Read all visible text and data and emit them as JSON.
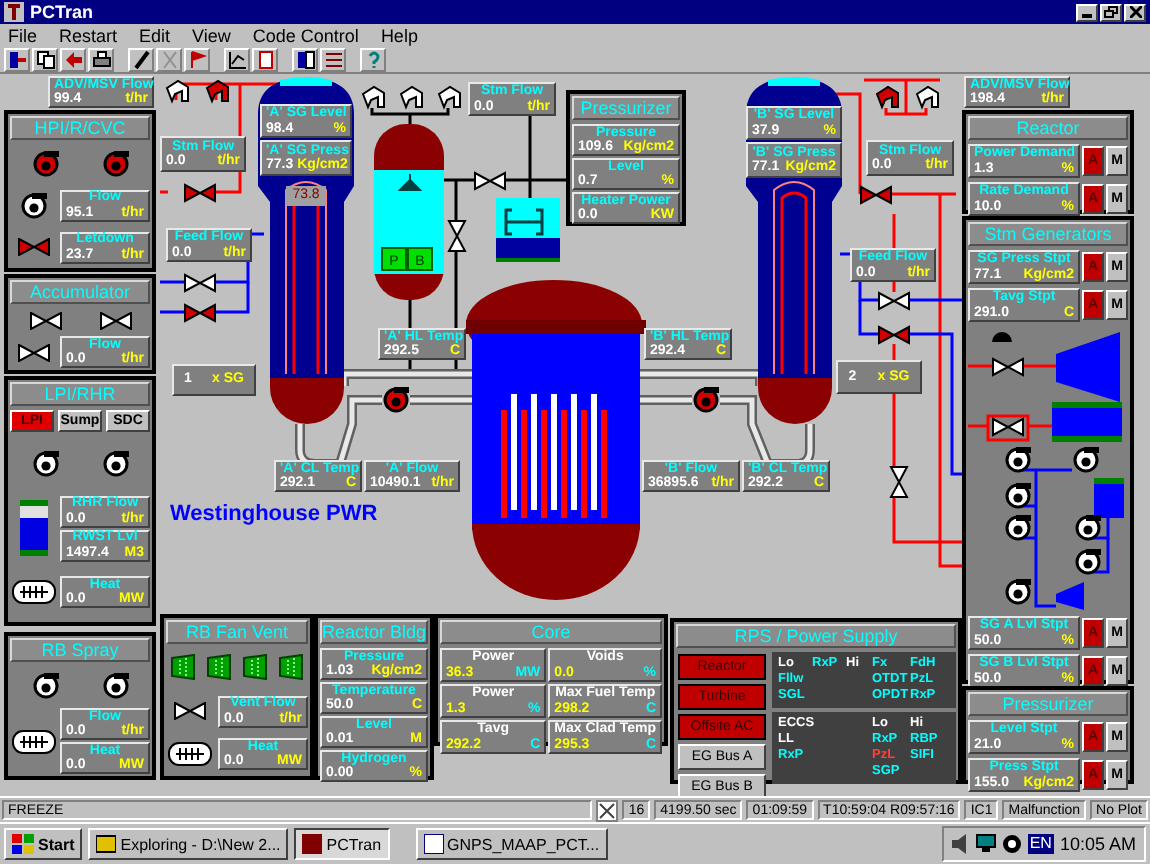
{
  "window": {
    "title": "PCTran"
  },
  "menu": [
    "File",
    "Restart",
    "Edit",
    "View",
    "Code Control",
    "Help"
  ],
  "plant": {
    "caption": "Westinghouse PWR",
    "readouts": [
      {
        "label": "ADV/MSV Flow",
        "value": "99.4",
        "unit": "t/hr"
      },
      {
        "label": "Stm Flow",
        "value": "0.0",
        "unit": "t/hr"
      },
      {
        "label": "'A' SG Level",
        "value": "98.4",
        "unit": "%"
      },
      {
        "label": "'A' SG Press",
        "value": "77.3",
        "unit": "Kg/cm2"
      },
      {
        "label": "Stm Flow",
        "value": "0.0",
        "unit": "t/hr"
      },
      {
        "label": "'B' SG Level",
        "value": "37.9",
        "unit": "%"
      },
      {
        "label": "'B' SG Press",
        "value": "77.1",
        "unit": "Kg/cm2"
      },
      {
        "label": "Stm Flow",
        "value": "0.0",
        "unit": "t/hr"
      },
      {
        "label": "ADV/MSV Flow",
        "value": "198.4",
        "unit": "t/hr"
      },
      {
        "label": "Feed Flow",
        "value": "0.0",
        "unit": "t/hr"
      },
      {
        "label": "Feed Flow",
        "value": "0.0",
        "unit": "t/hr"
      },
      {
        "label": "'A' HL Temp",
        "value": "292.5",
        "unit": "C"
      },
      {
        "label": "'B' HL Temp",
        "value": "292.4",
        "unit": "C"
      },
      {
        "label": "'A' CL Temp",
        "value": "292.1",
        "unit": "C"
      },
      {
        "label": "'A' Flow",
        "value": "10490.1",
        "unit": "t/hr"
      },
      {
        "label": "'B' Flow",
        "value": "36895.6",
        "unit": "t/hr"
      },
      {
        "label": "'B' CL Temp",
        "value": "292.2",
        "unit": "C"
      }
    ],
    "tube_reading": "73.8",
    "heaters": [
      "P",
      "B"
    ],
    "sg_loops": [
      {
        "count": "1",
        "unit": "x SG"
      },
      {
        "count": "2",
        "unit": "x SG"
      }
    ],
    "relief_valves": [
      {
        "on": false
      },
      {
        "on": true
      },
      {
        "on": false
      },
      {
        "on": false
      },
      {
        "on": false
      },
      {
        "on": true
      },
      {
        "on": false
      }
    ],
    "valves": [
      {
        "on": true
      },
      {
        "on": false
      },
      {
        "on": true
      },
      {
        "on": false
      },
      {
        "on": false
      },
      {
        "on": true
      },
      {
        "on": false
      },
      {
        "on": true
      },
      {
        "on": false
      }
    ],
    "pumps": [
      {
        "on": true
      },
      {
        "on": true
      }
    ]
  },
  "panels": [
    {
      "kind": "hpi",
      "title": "HPI/R/CVC",
      "pumps": [
        {
          "on": true
        },
        {
          "on": true
        },
        {
          "on": false
        }
      ],
      "valves": [
        {
          "on": true
        }
      ],
      "readouts": [
        {
          "label": "Flow",
          "value": "95.1",
          "unit": "t/hr"
        },
        {
          "label": "Letdown",
          "value": "23.7",
          "unit": "t/hr"
        }
      ]
    },
    {
      "kind": "accumulator",
      "title": "Accumulator",
      "valves": [
        {
          "on": false
        },
        {
          "on": false
        },
        {
          "on": false
        }
      ],
      "readouts": [
        {
          "label": "Flow",
          "value": "0.0",
          "unit": "t/hr"
        }
      ]
    },
    {
      "kind": "lpi",
      "title": "LPI/RHR",
      "buttons": [
        {
          "label": "LPI",
          "selected": true
        },
        {
          "label": "Sump",
          "selected": false
        },
        {
          "label": "SDC",
          "selected": false
        }
      ],
      "pumps": [
        {
          "on": false
        },
        {
          "on": false
        }
      ],
      "readouts": [
        {
          "label": "RHR Flow",
          "value": "0.0",
          "unit": "t/hr"
        },
        {
          "label": "RWST Lvl",
          "value": "1497.4",
          "unit": "M3"
        },
        {
          "label": "Heat",
          "value": "0.0",
          "unit": "MW"
        }
      ]
    },
    {
      "kind": "spray",
      "title": "RB Spray",
      "pumps": [
        {
          "on": false
        },
        {
          "on": false
        }
      ],
      "readouts": [
        {
          "label": "Flow",
          "value": "0.0",
          "unit": "t/hr"
        },
        {
          "label": "Heat",
          "value": "0.0",
          "unit": "MW"
        }
      ]
    },
    {
      "kind": "pressurizer",
      "title": "Pressurizer",
      "readouts": [
        {
          "label": "Pressure",
          "value": "109.6",
          "unit": "Kg/cm2"
        },
        {
          "label": "Level",
          "value": "0.7",
          "unit": "%"
        },
        {
          "label": "Heater Power",
          "value": "0.0",
          "unit": "KW"
        }
      ]
    },
    {
      "kind": "reactor",
      "title": "Reactor",
      "readouts": [
        {
          "label": "Power Demand",
          "value": "1.3",
          "unit": "%",
          "modes": [
            {
              "label": "A",
              "selected": true
            },
            {
              "label": "M",
              "selected": false
            }
          ]
        },
        {
          "label": "Rate Demand",
          "value": "10.0",
          "unit": "%",
          "modes": [
            {
              "label": "A",
              "selected": true
            },
            {
              "label": "M",
              "selected": false
            }
          ]
        }
      ]
    },
    {
      "kind": "steamgen",
      "title": "Stm Generators",
      "valves": [
        {
          "on": false
        },
        {
          "on": false
        }
      ],
      "pumps": [
        {
          "on": false
        },
        {
          "on": false
        },
        {
          "on": false
        },
        {
          "on": false
        },
        {
          "on": false
        },
        {
          "on": false
        },
        {
          "on": false
        }
      ],
      "readouts": [
        {
          "label": "SG Press Stpt",
          "value": "77.1",
          "unit": "Kg/cm2",
          "modes": [
            {
              "label": "A",
              "selected": true
            },
            {
              "label": "M",
              "selected": false
            }
          ]
        },
        {
          "label": "Tavg Stpt",
          "value": "291.0",
          "unit": "C",
          "modes": [
            {
              "label": "A",
              "selected": true
            },
            {
              "label": "M",
              "selected": false
            }
          ]
        },
        {
          "label": "SG A Lvl Stpt",
          "value": "50.0",
          "unit": "%",
          "modes": [
            {
              "label": "A",
              "selected": true
            },
            {
              "label": "M",
              "selected": false
            }
          ]
        },
        {
          "label": "SG B Lvl Stpt",
          "value": "50.0",
          "unit": "%",
          "modes": [
            {
              "label": "A",
              "selected": true
            },
            {
              "label": "M",
              "selected": false
            }
          ]
        }
      ]
    },
    {
      "kind": "setpoints",
      "title": "Pressurizer",
      "readouts": [
        {
          "label": "Level Stpt",
          "value": "21.0",
          "unit": "%",
          "modes": [
            {
              "label": "A",
              "selected": true
            },
            {
              "label": "M",
              "selected": false
            }
          ]
        },
        {
          "label": "Press Stpt",
          "value": "155.0",
          "unit": "Kg/cm2",
          "modes": [
            {
              "label": "A",
              "selected": true
            },
            {
              "label": "M",
              "selected": false
            }
          ]
        }
      ]
    },
    {
      "kind": "fanvent",
      "title": "RB Fan Vent",
      "valves": [
        {
          "on": false
        }
      ],
      "readouts": [
        {
          "label": "Vent Flow",
          "value": "0.0",
          "unit": "t/hr"
        },
        {
          "label": "Heat",
          "value": "0.0",
          "unit": "MW"
        }
      ]
    },
    {
      "kind": "building",
      "title": "Reactor Bldg",
      "readouts": [
        {
          "label": "Pressure",
          "value": "1.03",
          "unit": "Kg/cm2"
        },
        {
          "label": "Temperature",
          "value": "50.0",
          "unit": "C"
        },
        {
          "label": "Level",
          "value": "0.01",
          "unit": "M"
        },
        {
          "label": "Hydrogen",
          "value": "0.00",
          "unit": "%"
        }
      ]
    },
    {
      "kind": "core",
      "title": "Core",
      "readouts": [
        {
          "label": "Power",
          "value": "36.3",
          "unit": "MW"
        },
        {
          "label": "Voids",
          "value": "0.0",
          "unit": "%"
        },
        {
          "label": "Power",
          "value": "1.3",
          "unit": "%"
        },
        {
          "label": "Max Fuel Temp",
          "value": "298.2",
          "unit": "C"
        },
        {
          "label": "Tavg",
          "value": "292.2",
          "unit": "C"
        },
        {
          "label": "Max Clad Temp",
          "value": "295.3",
          "unit": "C"
        }
      ]
    },
    {
      "kind": "rps",
      "title": "RPS / Power Supply",
      "trips": [
        {
          "label": "Reactor",
          "tripped": true
        },
        {
          "label": "Turbine",
          "tripped": true
        },
        {
          "label": "Offsite AC",
          "tripped": true
        },
        {
          "label": "EG Bus A",
          "tripped": false
        },
        {
          "label": "EG Bus B",
          "tripped": false
        }
      ],
      "signals_top": [
        {
          "label": "Lo",
          "kind": "header"
        },
        {
          "label": "RxP",
          "kind": "signal",
          "tripped": false
        },
        {
          "label": "Hi",
          "kind": "header"
        },
        {
          "label": "Fx",
          "kind": "signal",
          "tripped": false
        },
        {
          "label": "FdH",
          "kind": "signal",
          "tripped": false
        },
        {
          "label": "Fllw",
          "kind": "signal",
          "tripped": false
        },
        {
          "label": "OTDT",
          "kind": "signal",
          "tripped": false
        },
        {
          "label": "PzL",
          "kind": "signal",
          "tripped": false
        },
        {
          "label": "SGL",
          "kind": "signal",
          "tripped": false
        },
        {
          "label": "OPDT",
          "kind": "signal",
          "tripped": false
        },
        {
          "label": "RxP",
          "kind": "signal",
          "tripped": false
        }
      ],
      "signals_bottom": [
        {
          "label": "ECCS",
          "kind": "header"
        },
        {
          "label": "Lo",
          "kind": "header"
        },
        {
          "label": "Hi",
          "kind": "header"
        },
        {
          "label": "LL",
          "kind": "header"
        },
        {
          "label": "RxP",
          "kind": "signal",
          "tripped": false
        },
        {
          "label": "RBP",
          "kind": "signal",
          "tripped": false
        },
        {
          "label": "RxP",
          "kind": "signal",
          "tripped": false
        },
        {
          "label": "PzL",
          "kind": "signal",
          "tripped": true
        },
        {
          "label": "SIFI",
          "kind": "signal",
          "tripped": false
        },
        {
          "label": "SGP",
          "kind": "signal",
          "tripped": false
        }
      ]
    }
  ],
  "status_bar": {
    "message": "FREEZE",
    "fields": [
      "16",
      "4199.50 sec",
      "01:09:59",
      "T10:59:04 R09:57:16",
      "IC1",
      "Malfunction",
      "No Plot"
    ]
  },
  "taskbar": {
    "start": "Start",
    "tasks": [
      {
        "label": "Exploring - D:\\New 2...",
        "selected": false
      },
      {
        "label": "PCTran",
        "selected": true
      },
      {
        "label": "GNPS_MAAP_PCT...",
        "selected": false
      }
    ],
    "language": "EN",
    "clock": "10:05 AM"
  }
}
